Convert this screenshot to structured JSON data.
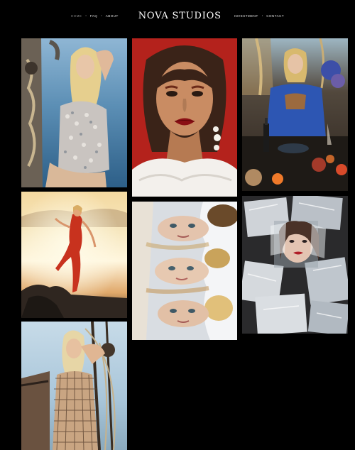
{
  "nav": {
    "left": [
      "Home",
      "FAQ",
      "About"
    ],
    "brand": "NOVA STUDIOS",
    "right": [
      "Investment",
      "Contact"
    ],
    "separator": "•"
  },
  "gallery": {
    "photos": [
      {
        "name": "photo-sequin-dress-boat"
      },
      {
        "name": "photo-red-lips-portrait"
      },
      {
        "name": "photo-blue-dress-feast"
      },
      {
        "name": "photo-sunset-red-jumpsuit"
      },
      {
        "name": "photo-three-faces-flowers"
      },
      {
        "name": "photo-ice-cubes-portrait"
      },
      {
        "name": "photo-net-dress-rigging"
      }
    ]
  },
  "colors": {
    "background": "#000000",
    "nav_text": "#e8e8e8",
    "nav_active": "#8a8a8a"
  }
}
